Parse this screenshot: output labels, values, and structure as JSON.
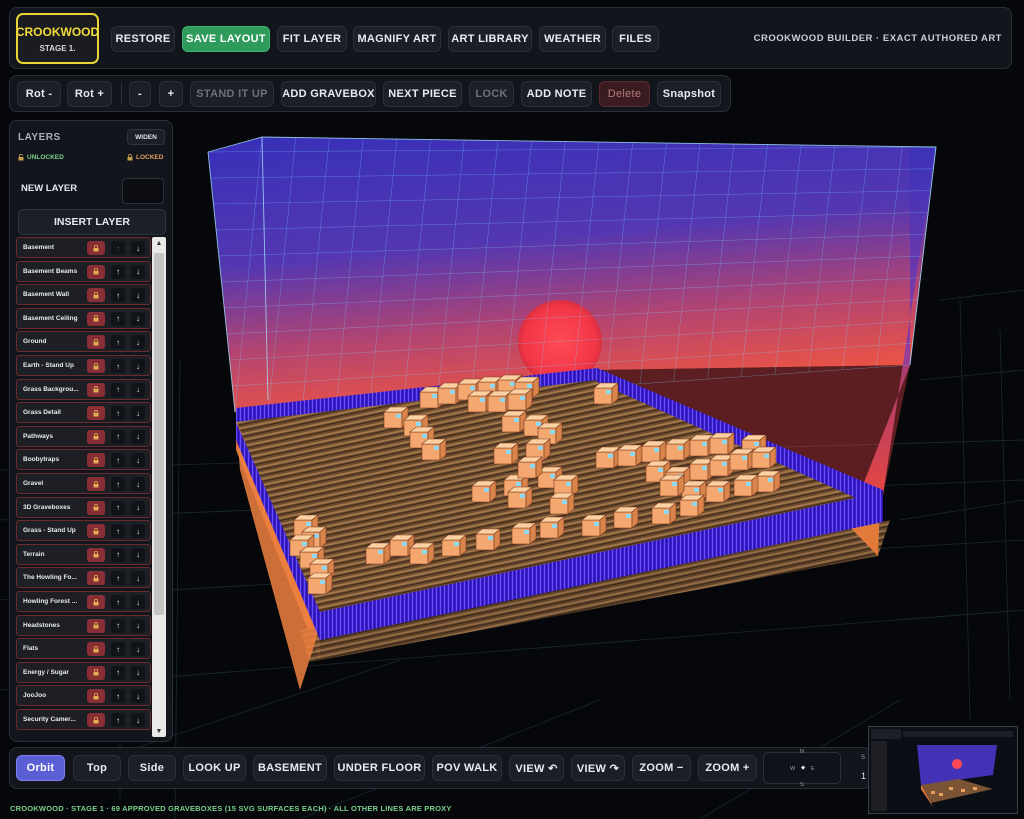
{
  "logo": {
    "title": "CROOKWOOD",
    "stage": "STAGE 1."
  },
  "top_toolbar": [
    "RESTORE",
    "SAVE LAYOUT",
    "FIT LAYER",
    "MAGNIFY ART",
    "ART LIBRARY",
    "WEATHER",
    "FILES"
  ],
  "brand_text": "CROOKWOOD BUILDER · EXACT AUTHORED ART",
  "edit_toolbar": [
    "Rot -",
    "Rot +",
    "-",
    "+",
    "STAND IT UP",
    "ADD GRAVEBOX",
    "NEXT PIECE",
    "LOCK",
    "ADD NOTE",
    "Delete",
    "Snapshot"
  ],
  "layers_panel": {
    "title": "LAYERS",
    "widen": "WIDEN",
    "unlocked": "UNLOCKED",
    "locked": "LOCKED",
    "new_layer": "NEW LAYER",
    "insert": "INSERT LAYER",
    "items": [
      "Basement",
      "Basement Beams",
      "Basement Wall",
      "Basement Ceiling",
      "Ground",
      "Earth - Stand Up",
      "Grass Backgrou...",
      "Grass Detail",
      "Pathways",
      "Boobytraps",
      "Gravel",
      "3D Graveboxes",
      "Grass - Stand Up",
      "Terrain",
      "The Howling Fo...",
      "Howling Forest ...",
      "Headstones",
      "Flats",
      "Energy / Sugar",
      "JooJoo",
      "Security Camer..."
    ]
  },
  "bottom_toolbar": [
    "Orbit",
    "Top",
    "Side",
    "LOOK UP",
    "BASEMENT",
    "UNDER FLOOR",
    "POV WALK",
    "VIEW ↶",
    "VIEW ↷",
    "ZOOM −",
    "ZOOM +"
  ],
  "compass": {
    "n": "N",
    "s": "S",
    "w": "W",
    "e": "E"
  },
  "right_edge_labels": {
    "top": "S",
    "bottom": "1"
  },
  "status_text": "CROOKWOOD · STAGE 1 · 69 APPROVED GRAVEBOXES (15 SVG SURFACES EACH) · ALL OTHER LINES ARE PROXY",
  "colors": {
    "accent_green": "#2e9b5a",
    "accent_orbit": "#5b5fd6",
    "logo_yellow": "#e7d335",
    "lock_red": "#8a2e35",
    "status_green": "#7bd08a"
  }
}
